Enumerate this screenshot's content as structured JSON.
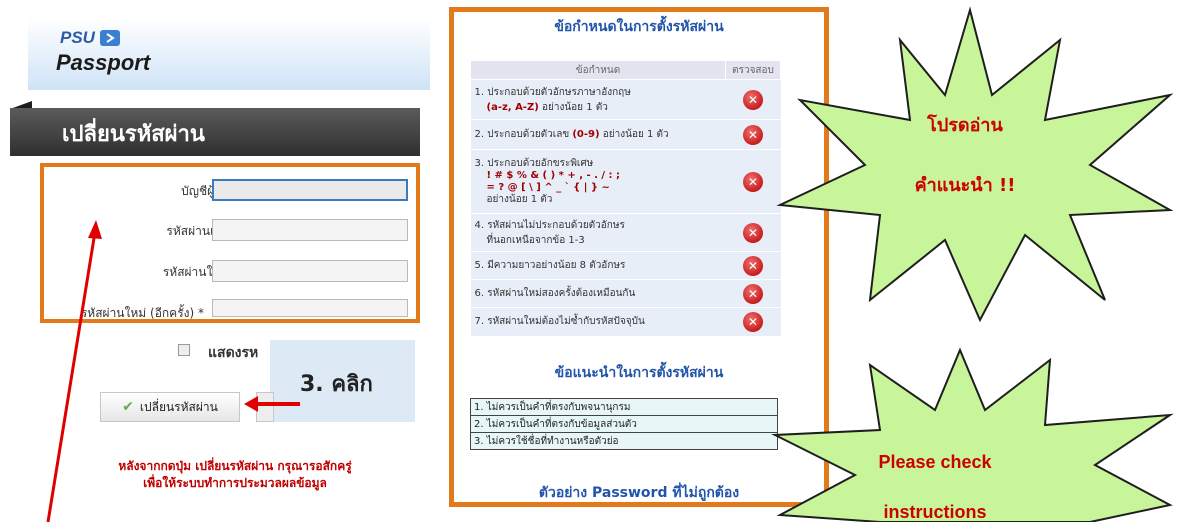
{
  "header": {
    "logo_top": "PSU",
    "logo_bottom": "Passport"
  },
  "page": {
    "title": "เปลี่ยนรหัสผ่าน"
  },
  "form": {
    "username_label": "บัญชีผู้ใช้ *",
    "old_password_label": "รหัสผ่านเก่า *",
    "new_password_label": "รหัสผ่านใหม่ *",
    "confirm_password_label": "รหัสผ่านใหม่ (อีกครั้ง) *",
    "show_password_label": "แสดงรห",
    "change_button_label": "เปลี่ยนรหัสผ่าน",
    "note_line1": "หลังจากกดปุ่ม เปลี่ยนรหัสผ่าน กรุณารอสักครู่",
    "note_line2": "เพื่อให้ระบบทำการประมวลผลข้อมูล"
  },
  "step_callout": {
    "text": "3. คลิก"
  },
  "rules": {
    "title": "ข้อกำหนดในการตั้งรหัสผ่าน",
    "col_rule": "ข้อกำหนด",
    "col_check": "ตรวจสอบ",
    "r1a": "1. ประกอบด้วยตัวอักษรภาษาอังกฤษ",
    "r1b": "(a-z, A-Z)",
    "r1c": " อย่างน้อย 1 ตัว",
    "r2a": "2. ประกอบด้วยตัวเลข ",
    "r2b": "(0-9)",
    "r2c": " อย่างน้อย 1 ตัว",
    "r3a": "3. ประกอบด้วยอักขระพิเศษ",
    "r3b": "! # $ % & ( ) * + , - . / : ;",
    "r3c": "= ? @ [ \\ ] ^ _ ` { | } ~",
    "r3d": "อย่างน้อย 1 ตัว",
    "r4a": "4. รหัสผ่านไม่ประกอบด้วยตัวอักษร",
    "r4b": "ที่นอกเหนือจากข้อ 1-3",
    "r5": "5. มีความยาวอย่างน้อย 8 ตัวอักษร",
    "r6": "6. รหัสผ่านใหม่สองครั้งต้องเหมือนกัน",
    "r7": "7. รหัสผ่านใหม่ต้องไม่ซ้ำกับรหัสปัจจุบัน"
  },
  "advice": {
    "title": "ข้อแนะนำในการตั้งรหัสผ่าน",
    "items": [
      "1. ไม่ควรเป็นคำที่ตรงกับพจนานุกรม",
      "2. ไม่ควรเป็นคำที่ตรงกับข้อมูลส่วนตัว",
      "3. ไม่ควรใช้ชื่อที่ทำงานหรือตัวย่อ"
    ]
  },
  "example": {
    "title": "ตัวอย่าง Password ที่ไม่ถูกต้อง"
  },
  "bubble_thai": {
    "line1": "โปรดอ่าน",
    "line2": "คำแนะนำ !!"
  },
  "bubble_en": {
    "line1": "Please check",
    "line2": "instructions"
  },
  "colors": {
    "accent_orange": "#e2791a",
    "burst_green": "#c8f59a",
    "arrow_red": "#e00000",
    "title_blue": "#2255aa"
  }
}
